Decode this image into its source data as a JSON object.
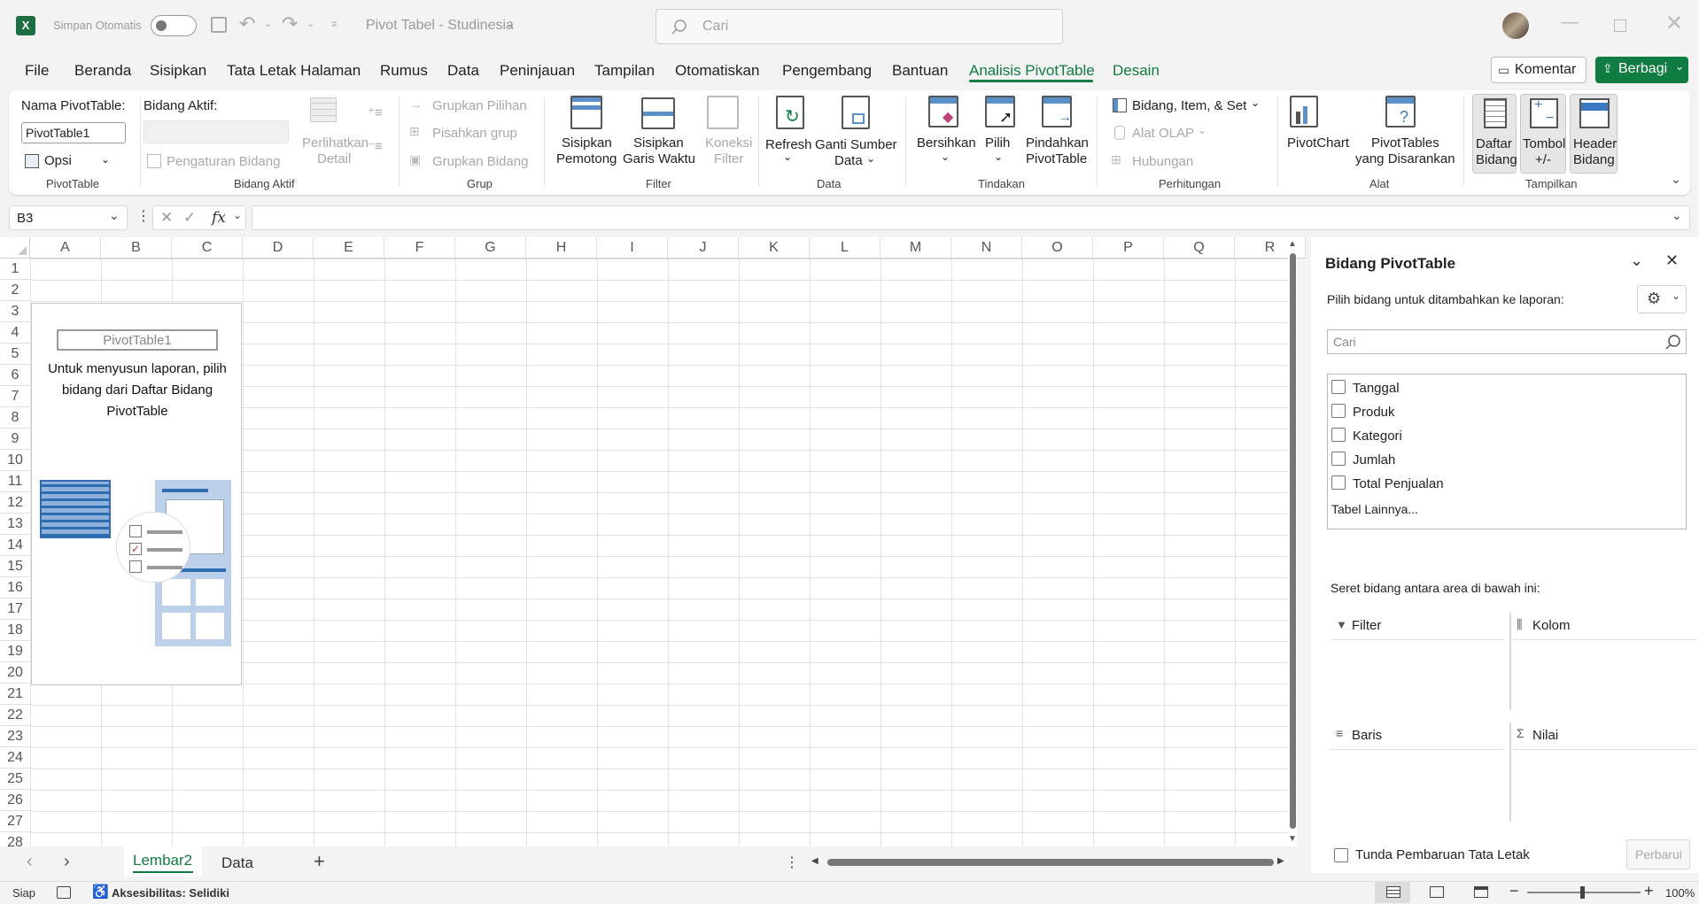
{
  "titlebar": {
    "autosave_label": "Simpan Otomatis",
    "doc_title": "Pivot Tabel - Studinesia",
    "search_placeholder": "Cari"
  },
  "menu": {
    "items": [
      "File",
      "Beranda",
      "Sisipkan",
      "Tata Letak Halaman",
      "Rumus",
      "Data",
      "Peninjauan",
      "Tampilan",
      "Otomatiskan",
      "Pengembang",
      "Bantuan",
      "Analisis PivotTable",
      "Desain"
    ],
    "comment_button": "Komentar",
    "share_button": "Berbagi"
  },
  "ribbon": {
    "pivottable": {
      "name_label": "Nama PivotTable:",
      "name_value": "PivotTable1",
      "options_label": "Opsi",
      "group_label": "PivotTable"
    },
    "active_field": {
      "label": "Bidang Aktif:",
      "field_settings": "Pengaturan Bidang",
      "show_detail_1": "Perlihatkan",
      "show_detail_2": "Detail",
      "group_label": "Bidang Aktif"
    },
    "group": {
      "group_selection": "Grupkan Pilihan",
      "ungroup": "Pisahkan grup",
      "group_field": "Grupkan Bidang",
      "group_label": "Grup"
    },
    "filter": {
      "insert_slicer_1": "Sisipkan",
      "insert_slicer_2": "Pemotong",
      "insert_timeline_1": "Sisipkan",
      "insert_timeline_2": "Garis Waktu",
      "filter_conn_1": "Koneksi",
      "filter_conn_2": "Filter",
      "group_label": "Filter"
    },
    "data": {
      "refresh": "Refresh",
      "change_source_1": "Ganti Sumber",
      "change_source_2": "Data",
      "group_label": "Data"
    },
    "actions": {
      "clear": "Bersihkan",
      "select": "Pilih",
      "move_1": "Pindahkan",
      "move_2": "PivotTable",
      "group_label": "Tindakan"
    },
    "calculations": {
      "fields_items_sets": "Bidang, Item, & Set",
      "olap_tools": "Alat OLAP",
      "relationships": "Hubungan",
      "group_label": "Perhitungan"
    },
    "tools": {
      "pivotchart": "PivotChart",
      "recommended_1": "PivotTables",
      "recommended_2": "yang Disarankan",
      "group_label": "Alat"
    },
    "show": {
      "field_list_1": "Daftar",
      "field_list_2": "Bidang",
      "buttons_1": "Tombol",
      "buttons_2": "+/-",
      "headers_1": "Header",
      "headers_2": "Bidang",
      "group_label": "Tampilkan"
    }
  },
  "formula_bar": {
    "name_box": "B3",
    "fx": "fx",
    "formula": ""
  },
  "grid": {
    "columns": [
      "A",
      "B",
      "C",
      "D",
      "E",
      "F",
      "G",
      "H",
      "I",
      "J",
      "K",
      "L",
      "M",
      "N",
      "O",
      "P",
      "Q",
      "R"
    ],
    "rows": [
      "1",
      "2",
      "3",
      "4",
      "5",
      "6",
      "7",
      "8",
      "9",
      "10",
      "11",
      "12",
      "13",
      "14",
      "15",
      "16",
      "17",
      "18",
      "19",
      "20",
      "21",
      "22",
      "23",
      "24",
      "25",
      "26",
      "27",
      "28"
    ],
    "pivot_placeholder_title": "PivotTable1",
    "pivot_placeholder_text": "Untuk menyusun laporan, pilih bidang dari Daftar Bidang PivotTable"
  },
  "sheets": {
    "tabs": [
      "Lembar2",
      "Data"
    ],
    "active": "Lembar2"
  },
  "pane": {
    "title": "Bidang PivotTable",
    "subtitle": "Pilih bidang untuk ditambahkan ke laporan:",
    "search_placeholder": "Cari",
    "fields": [
      "Tanggal",
      "Produk",
      "Kategori",
      "Jumlah",
      "Total Penjualan"
    ],
    "more_tables": "Tabel Lainnya...",
    "drag_hint": "Seret bidang antara area di bawah ini:",
    "areas": {
      "filter": "Filter",
      "columns": "Kolom",
      "rows": "Baris",
      "values": "Nilai"
    },
    "defer_label": "Tunda Pembaruan Tata Letak",
    "update_button": "Perbarui"
  },
  "status": {
    "ready": "Siap",
    "accessibility": "Aksesibilitas: Selidiki",
    "zoom": "100%"
  },
  "colors": {
    "accent_green": "#107c41",
    "excel_icon": "#1d6f42"
  }
}
